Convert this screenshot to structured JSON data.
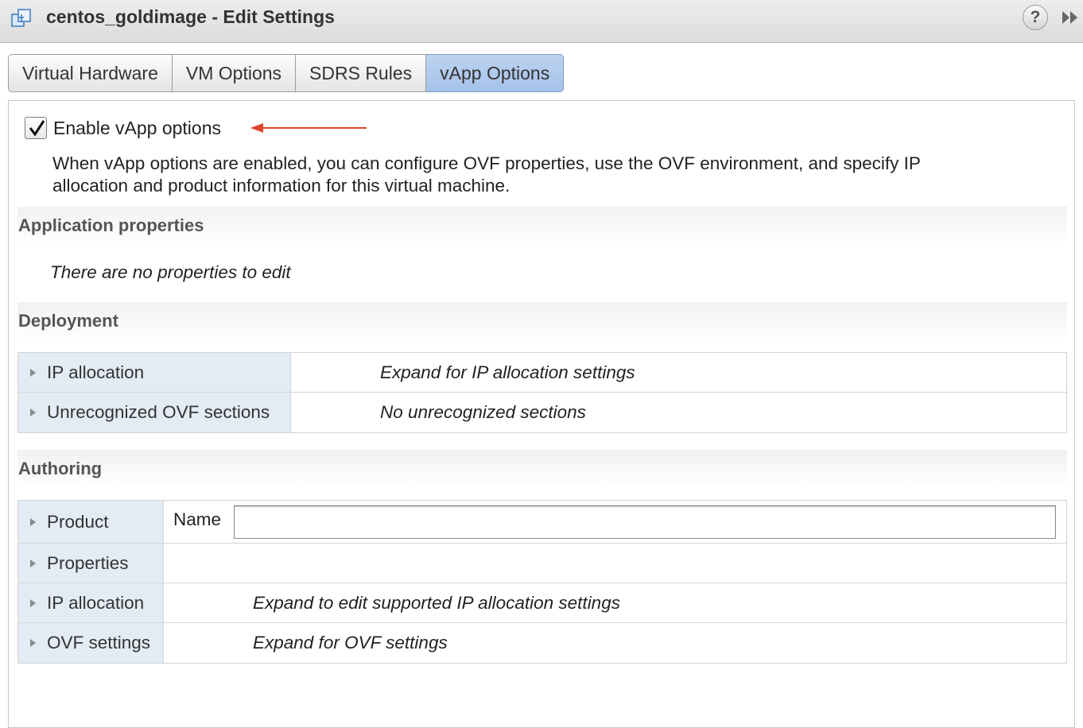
{
  "window": {
    "title": "centos_goldimage - Edit Settings",
    "help_glyph": "?"
  },
  "tabs": [
    {
      "label": "Virtual Hardware",
      "active": false
    },
    {
      "label": "VM Options",
      "active": false
    },
    {
      "label": "SDRS Rules",
      "active": false
    },
    {
      "label": "vApp Options",
      "active": true
    }
  ],
  "enable_vapp": {
    "label": "Enable vApp options",
    "checked": true,
    "description": "When vApp options are enabled, you can configure OVF properties, use the OVF environment, and specify IP allocation and product information for this virtual machine.",
    "annotation_arrow_color": "#e0452e"
  },
  "application_properties": {
    "heading": "Application properties",
    "empty_message": "There are no properties to edit"
  },
  "deployment": {
    "heading": "Deployment",
    "rows": [
      {
        "label": "IP allocation",
        "value": "Expand for IP allocation settings"
      },
      {
        "label": "Unrecognized OVF sections",
        "value": "No unrecognized sections"
      }
    ]
  },
  "authoring": {
    "heading": "Authoring",
    "product": {
      "label": "Product",
      "name_label": "Name",
      "name_value": ""
    },
    "rows": [
      {
        "label": "Properties",
        "value": ""
      },
      {
        "label": "IP allocation",
        "value": "Expand to edit supported IP allocation settings"
      },
      {
        "label": "OVF settings",
        "value": "Expand for OVF settings"
      }
    ]
  },
  "colors": {
    "active_tab": "#a6c2e8",
    "row_key_bg": "#e3ebf4"
  }
}
